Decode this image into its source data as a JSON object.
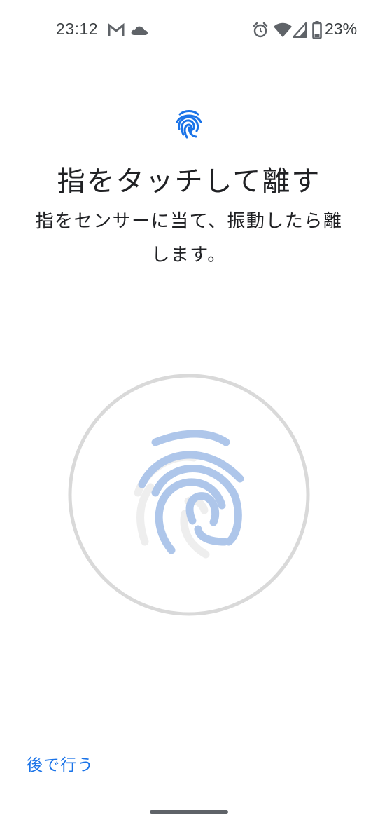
{
  "status_bar": {
    "time": "23:12",
    "battery_percent": "23%",
    "icons": [
      "gmail-icon",
      "cloud-icon",
      "alarm-icon",
      "wifi-icon",
      "signal-icon",
      "battery-icon"
    ]
  },
  "header": {
    "title": "指をタッチして離す",
    "description": "指をセンサーに当て、振動したら離します。"
  },
  "footer": {
    "later_label": "後で行う"
  },
  "colors": {
    "accent": "#1a73e8",
    "fingerprint_fill": "#aec6ea",
    "fingerprint_empty": "#eeeeee",
    "ring": "#d9d9d9"
  },
  "enrollment_progress": 0.0
}
